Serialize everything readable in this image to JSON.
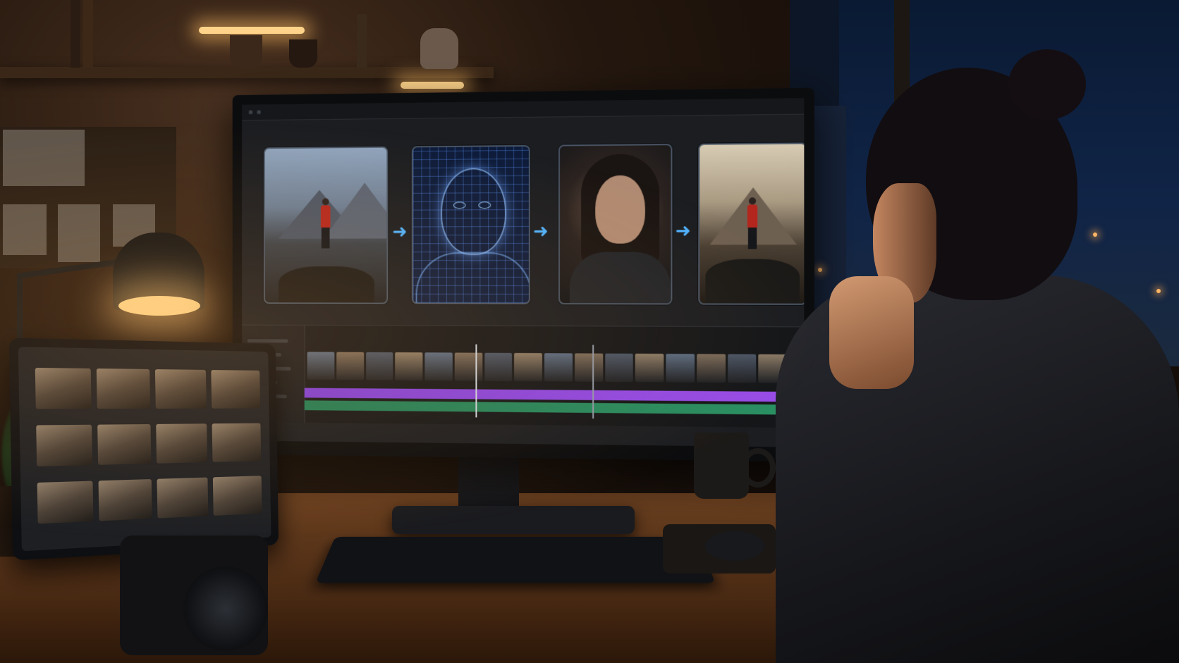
{
  "scene": {
    "description_tags": [
      "night-studio",
      "desk",
      "monitor",
      "tablet",
      "lamp",
      "person"
    ],
    "colors": {
      "warm_light": "#ffd48a",
      "accent_blue": "#4fb3ff",
      "track_purple": "#8a45df",
      "track_green": "#25865c",
      "jacket_red": "#b3261e"
    }
  },
  "monitor": {
    "panels": [
      {
        "kind": "landscape-hiker"
      },
      {
        "kind": "face-wireframe"
      },
      {
        "kind": "portrait"
      },
      {
        "kind": "landscape-hiker-final"
      }
    ],
    "arrow_icon": "arrow-right-icon",
    "timeline": {
      "thumbnail_count": 16,
      "tracks": [
        "purple",
        "green"
      ]
    }
  },
  "tablet": {
    "tile_rows": 3,
    "tile_cols": 4
  }
}
